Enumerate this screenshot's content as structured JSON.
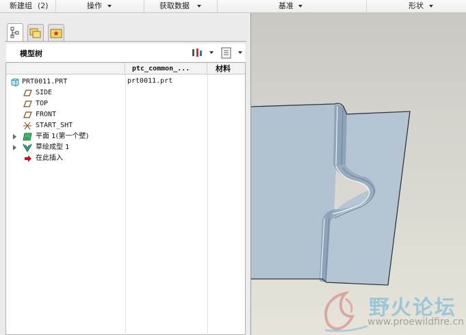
{
  "ribbon": {
    "groups": [
      {
        "label": "新建组",
        "count": "(2)"
      },
      {
        "label": "操作"
      },
      {
        "label": "获取数据"
      },
      {
        "label": "基准"
      },
      {
        "label": "形状"
      }
    ]
  },
  "panel": {
    "tabs": [
      "model-tree-tab",
      "folder-browser-tab",
      "favorites-tab"
    ],
    "title": "模型树",
    "columns": {
      "col2": "ptc_common_...",
      "col3": "材料"
    }
  },
  "tree": {
    "items": [
      {
        "label": "PRT0011.PRT",
        "icon": "part-icon",
        "value": "prt0011.prt"
      },
      {
        "label": "SIDE",
        "icon": "datum-plane-icon"
      },
      {
        "label": "TOP",
        "icon": "datum-plane-icon"
      },
      {
        "label": "FRONT",
        "icon": "datum-plane-icon"
      },
      {
        "label": "START_SHT",
        "icon": "coordinate-system-icon"
      },
      {
        "label": "平面 1(第一个壁)",
        "icon": "flat-wall-icon",
        "expandable": true
      },
      {
        "label": "草绘成型 1",
        "icon": "sketched-form-icon",
        "expandable": true
      },
      {
        "label": "在此插入",
        "icon": "insert-here-arrow-icon"
      }
    ]
  },
  "watermark": {
    "text_cn": "野火论坛",
    "url": "www.proewildfire.cn"
  },
  "colors": {
    "sheet_metal": "#b1c2d1",
    "viewport_bg": "#d6d4cd",
    "insert_arrow": "#c8101a"
  }
}
